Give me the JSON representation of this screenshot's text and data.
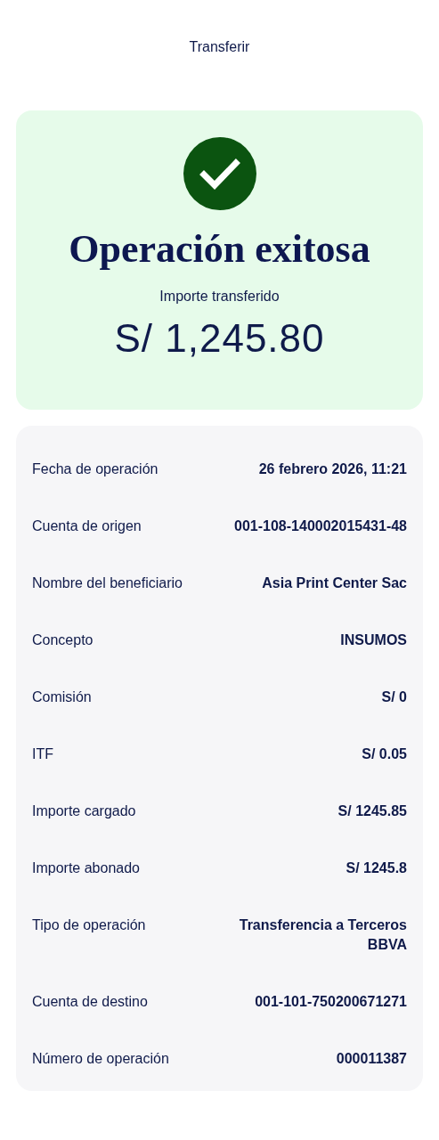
{
  "header": {
    "title": "Transferir"
  },
  "result": {
    "title": "Operación exitosa",
    "amount_label": "Importe transferido",
    "amount": "S/ 1,245.80"
  },
  "details": [
    {
      "label": "Fecha de operación",
      "value": "26 febrero 2026, 11:21"
    },
    {
      "label": "Cuenta de origen",
      "value": "001-108-140002015431-48"
    },
    {
      "label": "Nombre del beneficiario",
      "value": "Asia Print Center Sac"
    },
    {
      "label": "Concepto",
      "value": "INSUMOS"
    },
    {
      "label": "Comisión",
      "value": "S/ 0"
    },
    {
      "label": "ITF",
      "value": "S/ 0.05"
    },
    {
      "label": "Importe cargado",
      "value": "S/ 1245.85"
    },
    {
      "label": "Importe abonado",
      "value": "S/ 1245.8"
    },
    {
      "label": "Tipo de operación",
      "value": "Transferencia a Terceros BBVA"
    },
    {
      "label": "Cuenta de destino",
      "value": "001-101-750200671271"
    },
    {
      "label": "Número de operación",
      "value": "000011387"
    }
  ]
}
